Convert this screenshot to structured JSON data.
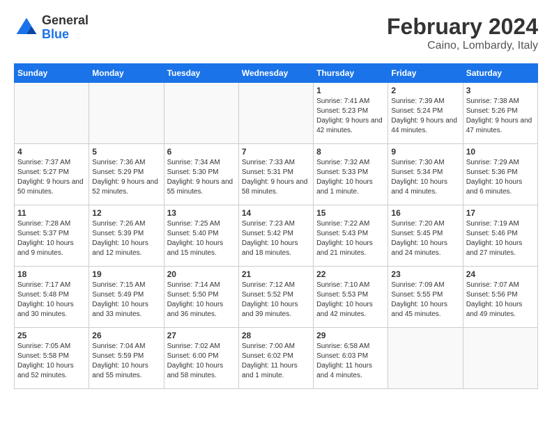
{
  "header": {
    "logo": {
      "general": "General",
      "blue": "Blue"
    },
    "title": "February 2024",
    "subtitle": "Caino, Lombardy, Italy"
  },
  "calendar": {
    "days_of_week": [
      "Sunday",
      "Monday",
      "Tuesday",
      "Wednesday",
      "Thursday",
      "Friday",
      "Saturday"
    ],
    "weeks": [
      [
        {
          "day": "",
          "info": ""
        },
        {
          "day": "",
          "info": ""
        },
        {
          "day": "",
          "info": ""
        },
        {
          "day": "",
          "info": ""
        },
        {
          "day": "1",
          "info": "Sunrise: 7:41 AM\nSunset: 5:23 PM\nDaylight: 9 hours and 42 minutes."
        },
        {
          "day": "2",
          "info": "Sunrise: 7:39 AM\nSunset: 5:24 PM\nDaylight: 9 hours and 44 minutes."
        },
        {
          "day": "3",
          "info": "Sunrise: 7:38 AM\nSunset: 5:26 PM\nDaylight: 9 hours and 47 minutes."
        }
      ],
      [
        {
          "day": "4",
          "info": "Sunrise: 7:37 AM\nSunset: 5:27 PM\nDaylight: 9 hours and 50 minutes."
        },
        {
          "day": "5",
          "info": "Sunrise: 7:36 AM\nSunset: 5:29 PM\nDaylight: 9 hours and 52 minutes."
        },
        {
          "day": "6",
          "info": "Sunrise: 7:34 AM\nSunset: 5:30 PM\nDaylight: 9 hours and 55 minutes."
        },
        {
          "day": "7",
          "info": "Sunrise: 7:33 AM\nSunset: 5:31 PM\nDaylight: 9 hours and 58 minutes."
        },
        {
          "day": "8",
          "info": "Sunrise: 7:32 AM\nSunset: 5:33 PM\nDaylight: 10 hours and 1 minute."
        },
        {
          "day": "9",
          "info": "Sunrise: 7:30 AM\nSunset: 5:34 PM\nDaylight: 10 hours and 4 minutes."
        },
        {
          "day": "10",
          "info": "Sunrise: 7:29 AM\nSunset: 5:36 PM\nDaylight: 10 hours and 6 minutes."
        }
      ],
      [
        {
          "day": "11",
          "info": "Sunrise: 7:28 AM\nSunset: 5:37 PM\nDaylight: 10 hours and 9 minutes."
        },
        {
          "day": "12",
          "info": "Sunrise: 7:26 AM\nSunset: 5:39 PM\nDaylight: 10 hours and 12 minutes."
        },
        {
          "day": "13",
          "info": "Sunrise: 7:25 AM\nSunset: 5:40 PM\nDaylight: 10 hours and 15 minutes."
        },
        {
          "day": "14",
          "info": "Sunrise: 7:23 AM\nSunset: 5:42 PM\nDaylight: 10 hours and 18 minutes."
        },
        {
          "day": "15",
          "info": "Sunrise: 7:22 AM\nSunset: 5:43 PM\nDaylight: 10 hours and 21 minutes."
        },
        {
          "day": "16",
          "info": "Sunrise: 7:20 AM\nSunset: 5:45 PM\nDaylight: 10 hours and 24 minutes."
        },
        {
          "day": "17",
          "info": "Sunrise: 7:19 AM\nSunset: 5:46 PM\nDaylight: 10 hours and 27 minutes."
        }
      ],
      [
        {
          "day": "18",
          "info": "Sunrise: 7:17 AM\nSunset: 5:48 PM\nDaylight: 10 hours and 30 minutes."
        },
        {
          "day": "19",
          "info": "Sunrise: 7:15 AM\nSunset: 5:49 PM\nDaylight: 10 hours and 33 minutes."
        },
        {
          "day": "20",
          "info": "Sunrise: 7:14 AM\nSunset: 5:50 PM\nDaylight: 10 hours and 36 minutes."
        },
        {
          "day": "21",
          "info": "Sunrise: 7:12 AM\nSunset: 5:52 PM\nDaylight: 10 hours and 39 minutes."
        },
        {
          "day": "22",
          "info": "Sunrise: 7:10 AM\nSunset: 5:53 PM\nDaylight: 10 hours and 42 minutes."
        },
        {
          "day": "23",
          "info": "Sunrise: 7:09 AM\nSunset: 5:55 PM\nDaylight: 10 hours and 45 minutes."
        },
        {
          "day": "24",
          "info": "Sunrise: 7:07 AM\nSunset: 5:56 PM\nDaylight: 10 hours and 49 minutes."
        }
      ],
      [
        {
          "day": "25",
          "info": "Sunrise: 7:05 AM\nSunset: 5:58 PM\nDaylight: 10 hours and 52 minutes."
        },
        {
          "day": "26",
          "info": "Sunrise: 7:04 AM\nSunset: 5:59 PM\nDaylight: 10 hours and 55 minutes."
        },
        {
          "day": "27",
          "info": "Sunrise: 7:02 AM\nSunset: 6:00 PM\nDaylight: 10 hours and 58 minutes."
        },
        {
          "day": "28",
          "info": "Sunrise: 7:00 AM\nSunset: 6:02 PM\nDaylight: 11 hours and 1 minute."
        },
        {
          "day": "29",
          "info": "Sunrise: 6:58 AM\nSunset: 6:03 PM\nDaylight: 11 hours and 4 minutes."
        },
        {
          "day": "",
          "info": ""
        },
        {
          "day": "",
          "info": ""
        }
      ]
    ]
  }
}
